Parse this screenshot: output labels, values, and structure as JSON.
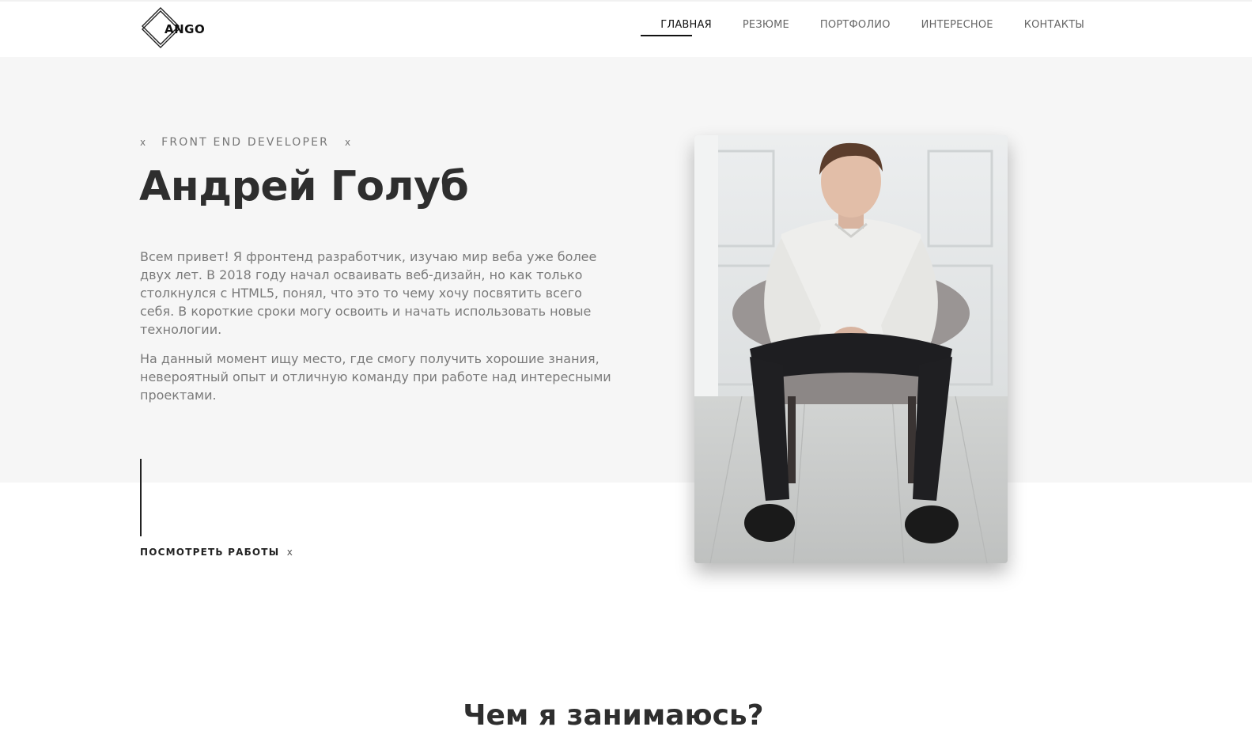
{
  "header": {
    "logo_text": "ANGO",
    "nav": [
      {
        "label": "ГЛАВНАЯ",
        "active": true
      },
      {
        "label": "РЕЗЮМЕ",
        "active": false
      },
      {
        "label": "ПОРТФОЛИО",
        "active": false
      },
      {
        "label": "ИНТЕРЕСНОЕ",
        "active": false
      },
      {
        "label": "КОНТАКТЫ",
        "active": false
      }
    ]
  },
  "hero": {
    "eyebrow_mark": "x",
    "eyebrow": "FRONT END DEVELOPER",
    "name": "Андрей Голуб",
    "paragraph1": "Всем привет! Я фронтенд разработчик, изучаю мир веба уже более двух лет. В 2018 году начал осваивать веб-дизайн, но как только столкнулся с HTML5, понял, что это то чему хочу посвятить всего себя. В короткие сроки могу освоить и начать использовать новые технологии.",
    "paragraph2": "На данный момент ищу место, где смогу получить хорошие знания, невероятный опыт и отличную команду при работе над интересными проектами.",
    "works_button": "ПОСМОТРЕТЬ РАБОТЫ",
    "works_mark": "x"
  },
  "section": {
    "title": "Чем я занимаюсь?"
  },
  "colors": {
    "hero_bg": "#f6f6f6",
    "text_dark": "#2e2e2e",
    "text_muted": "#7a7a7a"
  }
}
